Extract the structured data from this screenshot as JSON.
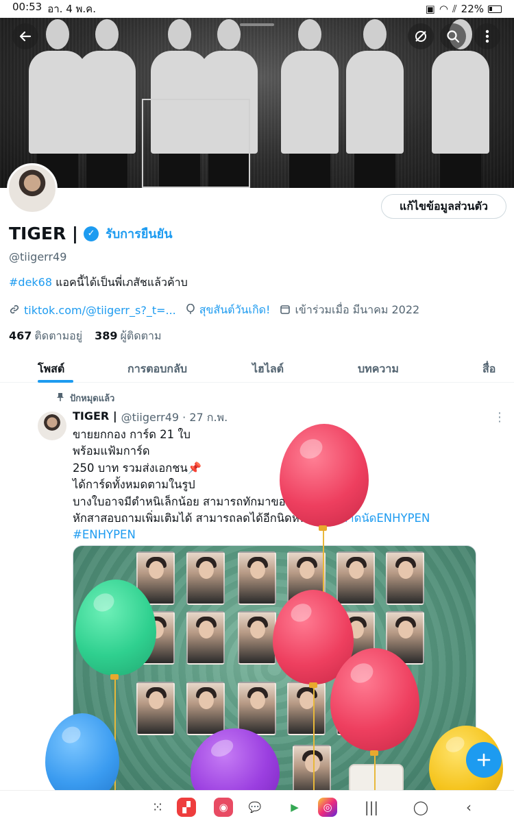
{
  "status": {
    "time": "00:53",
    "date": "อา. 4 พ.ค.",
    "battery": "22%"
  },
  "profile": {
    "name": "TIGER |",
    "get_verified": "รับการยืนยัน",
    "handle": "@tiigerr49",
    "bio_hashtag": "#dek68",
    "bio_text": " แอคนี้ได้เป็นพี่เภสัชแล้วค้าบ",
    "link": "tiktok.com/@tiigerr_s?_t=...",
    "birthday": "สุขสันต์วันเกิด!",
    "joined": "เข้าร่วมเมื่อ มีนาคม 2022",
    "following_count": "467",
    "following_label": "ติดตามอยู่",
    "followers_count": "389",
    "followers_label": "ผู้ติดตาม",
    "edit_label": "แก้ไขข้อมูลส่วนตัว"
  },
  "tabs": [
    "โพสต์",
    "การตอบกลับ",
    "ไฮไลต์",
    "บทความ",
    "สื่อ"
  ],
  "tweet": {
    "pinned_label": "ปักหมุดแล้ว",
    "author": "TIGER |",
    "handle_time": "@tiigerr49 · 27 ก.พ.",
    "lines": [
      "ขายยกกอง การ์ด 21 ใบ",
      "พร้อมแฟ้มการ์ด",
      "250 บาท รวมส่งเอกชน📌",
      "ได้การ์ดทั้งหมดตามในรูป",
      "บางใบอาจมีตำหนิเล็กน้อย สามารถทักมาขอดูได้ค่ะ",
      "หักสาสอบถามเพิ่มเติมได้ สามารถลดได้อีกนิดหน่อย "
    ],
    "hashtag1": "#ตลาดนัดENHYPEN",
    "hashtag2": "#ENHYPEN"
  },
  "icons": {
    "back": "arrow-left",
    "grok": "slash-circle",
    "search": "search",
    "more": "more-vertical",
    "verified": "check-badge",
    "link": "link",
    "birthday": "balloon",
    "calendar": "calendar",
    "pin": "pin",
    "compose": "plus"
  },
  "colors": {
    "accent": "#1d9bf0",
    "text": "#0f1419",
    "muted": "#536471"
  }
}
